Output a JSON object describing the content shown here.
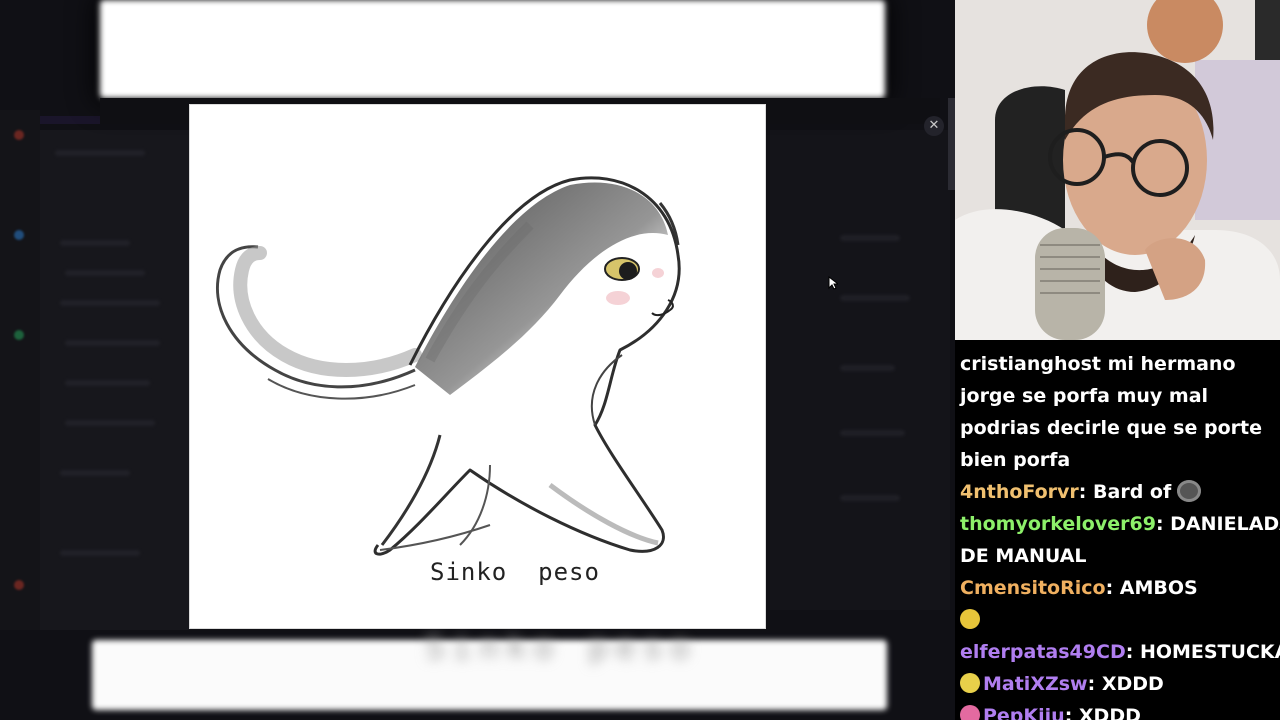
{
  "viewer": {
    "close_glyph": "✕",
    "caption": "Sinko  peso"
  },
  "chat": {
    "messages": [
      {
        "user": "cristianghost",
        "user_color": "#ffffff",
        "sep": " ",
        "text": "mi hermano jorge se porfa muy mal podrias decirle que se porte bien porfa",
        "badge": null,
        "emote": null
      },
      {
        "user": "4nthoForvr",
        "user_color": "#f0c070",
        "sep": ": ",
        "text": "Bard of",
        "badge": null,
        "emote": "bard-emote"
      },
      {
        "user": "thomyorkelover69",
        "user_color": "#8df06a",
        "sep": ": ",
        "text": "DANIELADA DE MANUAL",
        "badge": null,
        "emote": null
      },
      {
        "user": "CmensitoRico",
        "user_color": "#f0b060",
        "sep": ": ",
        "text": "AMBOS",
        "badge": null,
        "emote": null
      },
      {
        "user": "elferpatas49CD",
        "user_color": "#b07ef0",
        "sep": ": ",
        "text": "HOMESTUCKAZO",
        "badge": "sunglasses-badge",
        "badge_color": "#e7c53a",
        "emote": null
      },
      {
        "user": "MatiXZsw",
        "user_color": "#b07ef0",
        "sep": ": ",
        "text": "XDDD",
        "badge": "bell-badge",
        "badge_color": "#e8d04a",
        "emote": null
      },
      {
        "user": "PepKiiu",
        "user_color": "#b07ef0",
        "sep": ": ",
        "text": "XDDD",
        "badge": "gem-badge",
        "badge_color": "#e36aa0",
        "emote": null
      }
    ]
  }
}
